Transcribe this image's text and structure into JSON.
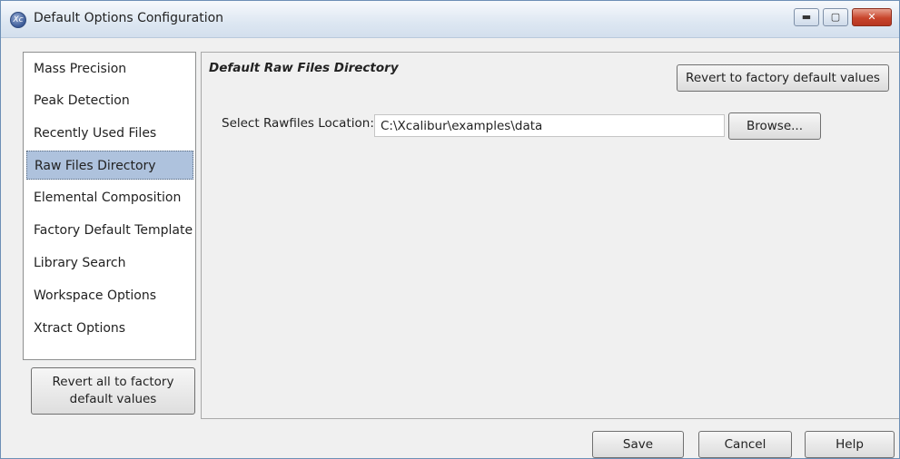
{
  "window": {
    "title": "Default Options Configuration",
    "app_icon_glyph": "Xc",
    "controls": {
      "minimize": "▬",
      "maximize": "▢",
      "close": "✕"
    }
  },
  "sidebar": {
    "items": [
      {
        "label": "Mass Precision",
        "selected": false
      },
      {
        "label": "Peak Detection",
        "selected": false
      },
      {
        "label": "Recently Used Files",
        "selected": false
      },
      {
        "label": "Raw Files Directory",
        "selected": true
      },
      {
        "label": "Elemental Composition",
        "selected": false
      },
      {
        "label": "Factory Default Template",
        "selected": false
      },
      {
        "label": "Library Search",
        "selected": false
      },
      {
        "label": "Workspace Options",
        "selected": false
      },
      {
        "label": "Xtract Options",
        "selected": false
      }
    ],
    "revert_all_label": "Revert all to factory default values"
  },
  "panel": {
    "section_title": "Default Raw Files Directory",
    "revert_factory_label": "Revert to factory default values",
    "location_label": "Select Rawfiles Location:",
    "location_value": "C:\\Xcalibur\\examples\\data",
    "browse_label": "Browse..."
  },
  "footer": {
    "save_label": "Save",
    "cancel_label": "Cancel",
    "help_label": "Help"
  },
  "colors": {
    "selection_bg": "#aec2dd",
    "titlebar_bg": "#dde7f2",
    "close_button": "#c8452c"
  }
}
